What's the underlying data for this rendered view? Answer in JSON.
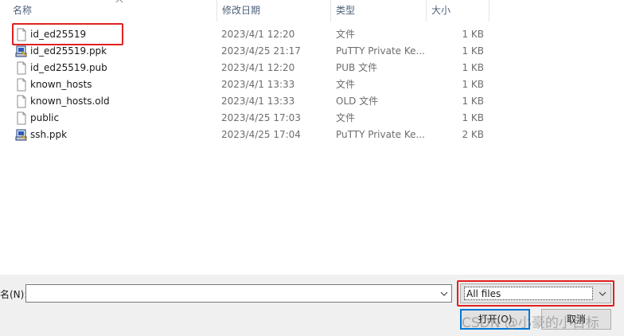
{
  "columns": {
    "name": "名称",
    "date": "修改日期",
    "type": "类型",
    "size": "大小"
  },
  "files": [
    {
      "name": "id_ed25519",
      "date": "2023/4/1 12:20",
      "type": "文件",
      "size": "1 KB",
      "icon": "blank-file-icon"
    },
    {
      "name": "id_ed25519.ppk",
      "date": "2023/4/25 21:17",
      "type": "PuTTY Private Ke...",
      "size": "1 KB",
      "icon": "putty-key-icon"
    },
    {
      "name": "id_ed25519.pub",
      "date": "2023/4/1 12:20",
      "type": "PUB 文件",
      "size": "1 KB",
      "icon": "blank-file-icon"
    },
    {
      "name": "known_hosts",
      "date": "2023/4/1 13:33",
      "type": "文件",
      "size": "1 KB",
      "icon": "blank-file-icon"
    },
    {
      "name": "known_hosts.old",
      "date": "2023/4/1 13:33",
      "type": "OLD 文件",
      "size": "1 KB",
      "icon": "blank-file-icon"
    },
    {
      "name": "public",
      "date": "2023/4/25 17:03",
      "type": "文件",
      "size": "1 KB",
      "icon": "blank-file-icon"
    },
    {
      "name": "ssh.ppk",
      "date": "2023/4/25 17:04",
      "type": "PuTTY Private Ke...",
      "size": "2 KB",
      "icon": "putty-key-icon"
    }
  ],
  "footer": {
    "filename_label": "名(N):",
    "filename_value": "",
    "filter_value": "All files",
    "open_label": "打开(O)",
    "cancel_label": "取消",
    "watermark": "CSDN @小豪的小目标"
  },
  "colors": {
    "highlight": "#e02020",
    "header_text": "#4c607a",
    "focus_border": "#0078d7"
  }
}
